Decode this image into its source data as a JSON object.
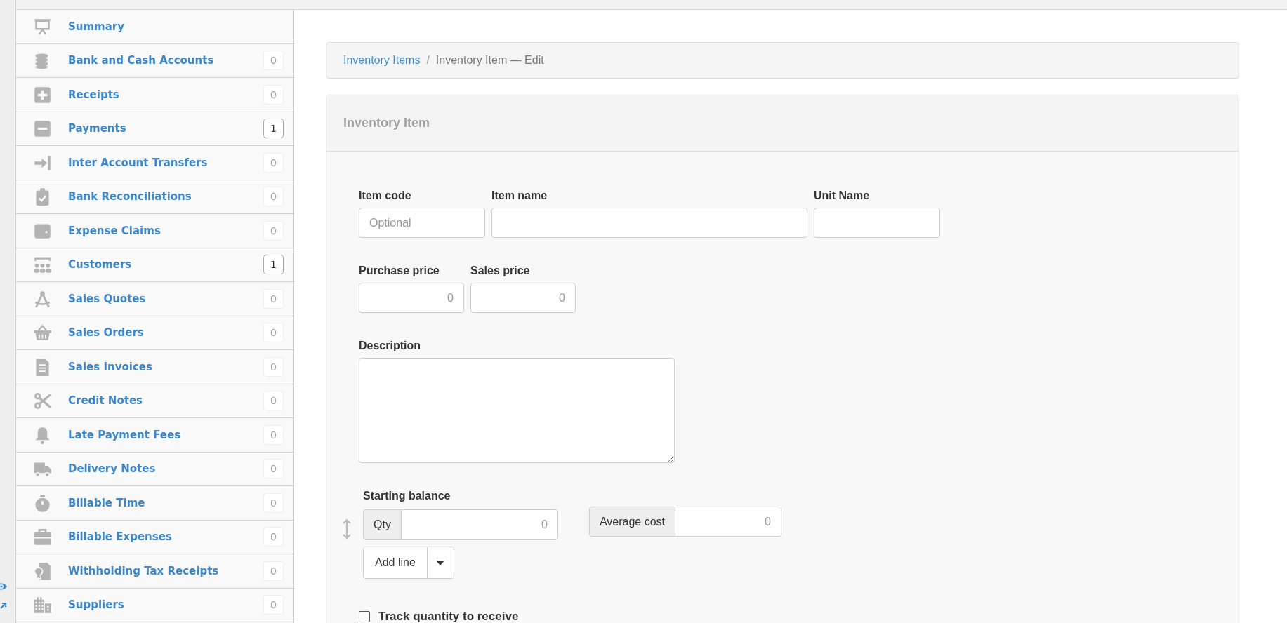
{
  "sidebar": {
    "items": [
      {
        "label": "Summary"
      },
      {
        "label": "Bank and Cash Accounts",
        "count": "0",
        "highlighted": false
      },
      {
        "label": "Receipts",
        "count": "0",
        "highlighted": false
      },
      {
        "label": "Payments",
        "count": "1",
        "highlighted": true
      },
      {
        "label": "Inter Account Transfers",
        "count": "0",
        "highlighted": false
      },
      {
        "label": "Bank Reconciliations",
        "count": "0",
        "highlighted": false
      },
      {
        "label": "Expense Claims",
        "count": "0",
        "highlighted": false
      },
      {
        "label": "Customers",
        "count": "1",
        "highlighted": true
      },
      {
        "label": "Sales Quotes",
        "count": "0",
        "highlighted": false
      },
      {
        "label": "Sales Orders",
        "count": "0",
        "highlighted": false
      },
      {
        "label": "Sales Invoices",
        "count": "0",
        "highlighted": false
      },
      {
        "label": "Credit Notes",
        "count": "0",
        "highlighted": false
      },
      {
        "label": "Late Payment Fees",
        "count": "0",
        "highlighted": false
      },
      {
        "label": "Delivery Notes",
        "count": "0",
        "highlighted": false
      },
      {
        "label": "Billable Time",
        "count": "0",
        "highlighted": false
      },
      {
        "label": "Billable Expenses",
        "count": "0",
        "highlighted": false
      },
      {
        "label": "Withholding Tax Receipts",
        "count": "0",
        "highlighted": false
      },
      {
        "label": "Suppliers",
        "count": "0",
        "highlighted": false
      }
    ]
  },
  "breadcrumb": {
    "link": "Inventory Items",
    "separator": "/",
    "current": "Inventory Item — Edit"
  },
  "panel": {
    "title": "Inventory Item",
    "item_code": {
      "label": "Item code",
      "placeholder": "Optional"
    },
    "item_name": {
      "label": "Item name"
    },
    "unit_name": {
      "label": "Unit Name"
    },
    "purchase_price": {
      "label": "Purchase price",
      "placeholder": "0"
    },
    "sales_price": {
      "label": "Sales price",
      "placeholder": "0"
    },
    "description": {
      "label": "Description"
    },
    "starting_balance": {
      "label": "Starting balance",
      "qty": {
        "addon": "Qty",
        "placeholder": "0"
      },
      "average_cost": {
        "addon": "Average cost",
        "placeholder": "0"
      },
      "add_line": "Add line"
    },
    "track_quantity": {
      "label": "Track quantity to receive",
      "checked": false
    }
  }
}
